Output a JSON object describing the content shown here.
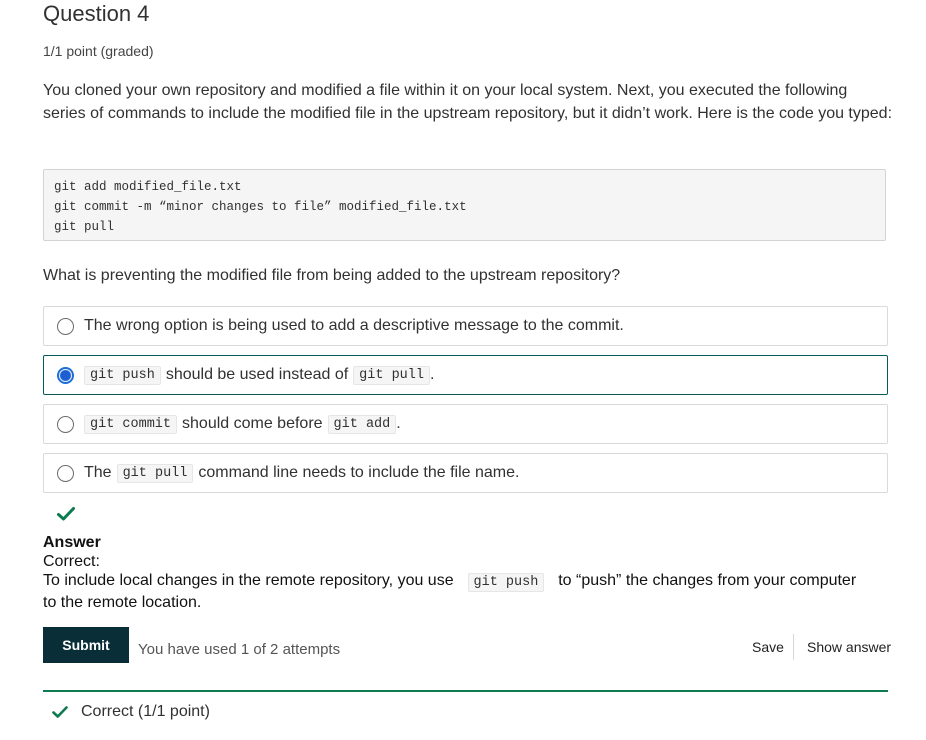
{
  "question": {
    "title": "Question 4",
    "points": "1/1 point (graded)",
    "text": "You cloned your own repository and modified a file within it on your local system. Next, you executed the following series of commands to include the modified file in the upstream repository, but it didn’t work. Here is the code you typed:",
    "code_lines": [
      "git add modified_file.txt",
      "git commit -m “minor changes to file” modified_file.txt",
      "git pull"
    ],
    "prompt": "What is preventing the modified file from being added to the upstream repository?"
  },
  "choices": [
    {
      "text": "The wrong option is being used to add a descriptive message to the commit."
    },
    {
      "code1": "git push",
      "text1": "should be used instead of",
      "code2": "git pull",
      "text2": "."
    },
    {
      "code1": "git commit",
      "text1": "should come before",
      "code2": "git add",
      "text2": "."
    },
    {
      "text1": "The",
      "code1": "git pull",
      "text2": "command line needs to include the file name."
    }
  ],
  "selected_index": 1,
  "answer": {
    "heading": "Answer",
    "status": "Correct:",
    "text_before": "To include local changes in the remote repository, you use",
    "code": "git push",
    "text_after": "to “push” the changes from your computer to the remote location."
  },
  "actions": {
    "submit": "Submit",
    "attempts": "You have used 1 of 2 attempts",
    "save": "Save",
    "show_answer": "Show answer"
  },
  "result": "Correct (1/1 point)",
  "colors": {
    "success": "#0d7a4f",
    "submit_bg": "#0a2e38",
    "radio_selected": "#1d5fd3"
  },
  "icons": {
    "answer_icon": "checkmark-icon",
    "result_icon": "checkmark-icon"
  }
}
